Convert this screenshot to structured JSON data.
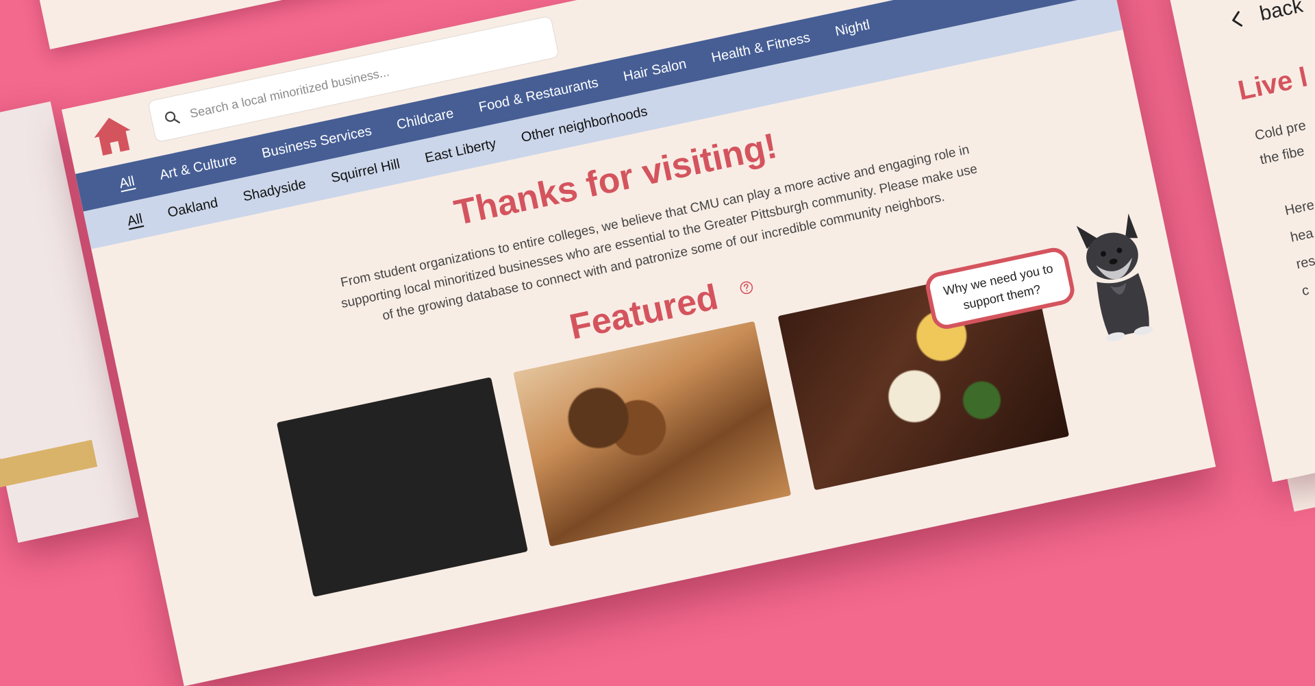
{
  "search": {
    "placeholder": "Search a local minoritized business..."
  },
  "categories": [
    {
      "label": "All",
      "active": true
    },
    {
      "label": "Art & Culture"
    },
    {
      "label": "Business Services"
    },
    {
      "label": "Childcare"
    },
    {
      "label": "Food & Restaurants"
    },
    {
      "label": "Hair Salon"
    },
    {
      "label": "Health & Fitness"
    },
    {
      "label": "Nightl"
    }
  ],
  "neighborhoods": [
    {
      "label": "All",
      "active": true
    },
    {
      "label": "Oakland"
    },
    {
      "label": "Shadyside"
    },
    {
      "label": "Squirrel Hill"
    },
    {
      "label": "East Liberty"
    },
    {
      "label": "Other neighborhoods"
    }
  ],
  "hero": {
    "title": "Thanks for visiting!",
    "text": "From student organizations to entire colleges, we believe that CMU can play a more active and engaging role in supporting local minoritized businesses who are essential to the Greater Pittsburgh community. Please make use of the growing database to connect with and patronize some of our incredible community neighbors."
  },
  "featured": {
    "title": "Featured",
    "bubble": "Why we need you to support them?"
  },
  "side_panel": {
    "back_label": "back",
    "title": "Live l",
    "lines": [
      "Cold pre",
      "the fibe",
      "Here",
      "hea",
      "res",
      "c"
    ]
  },
  "colors": {
    "brand_red": "#d4545e",
    "nav_blue": "#465e94",
    "nav_light": "#cbd6ea",
    "page_bg": "#f8ede5",
    "backdrop_pink": "#f3688d"
  }
}
